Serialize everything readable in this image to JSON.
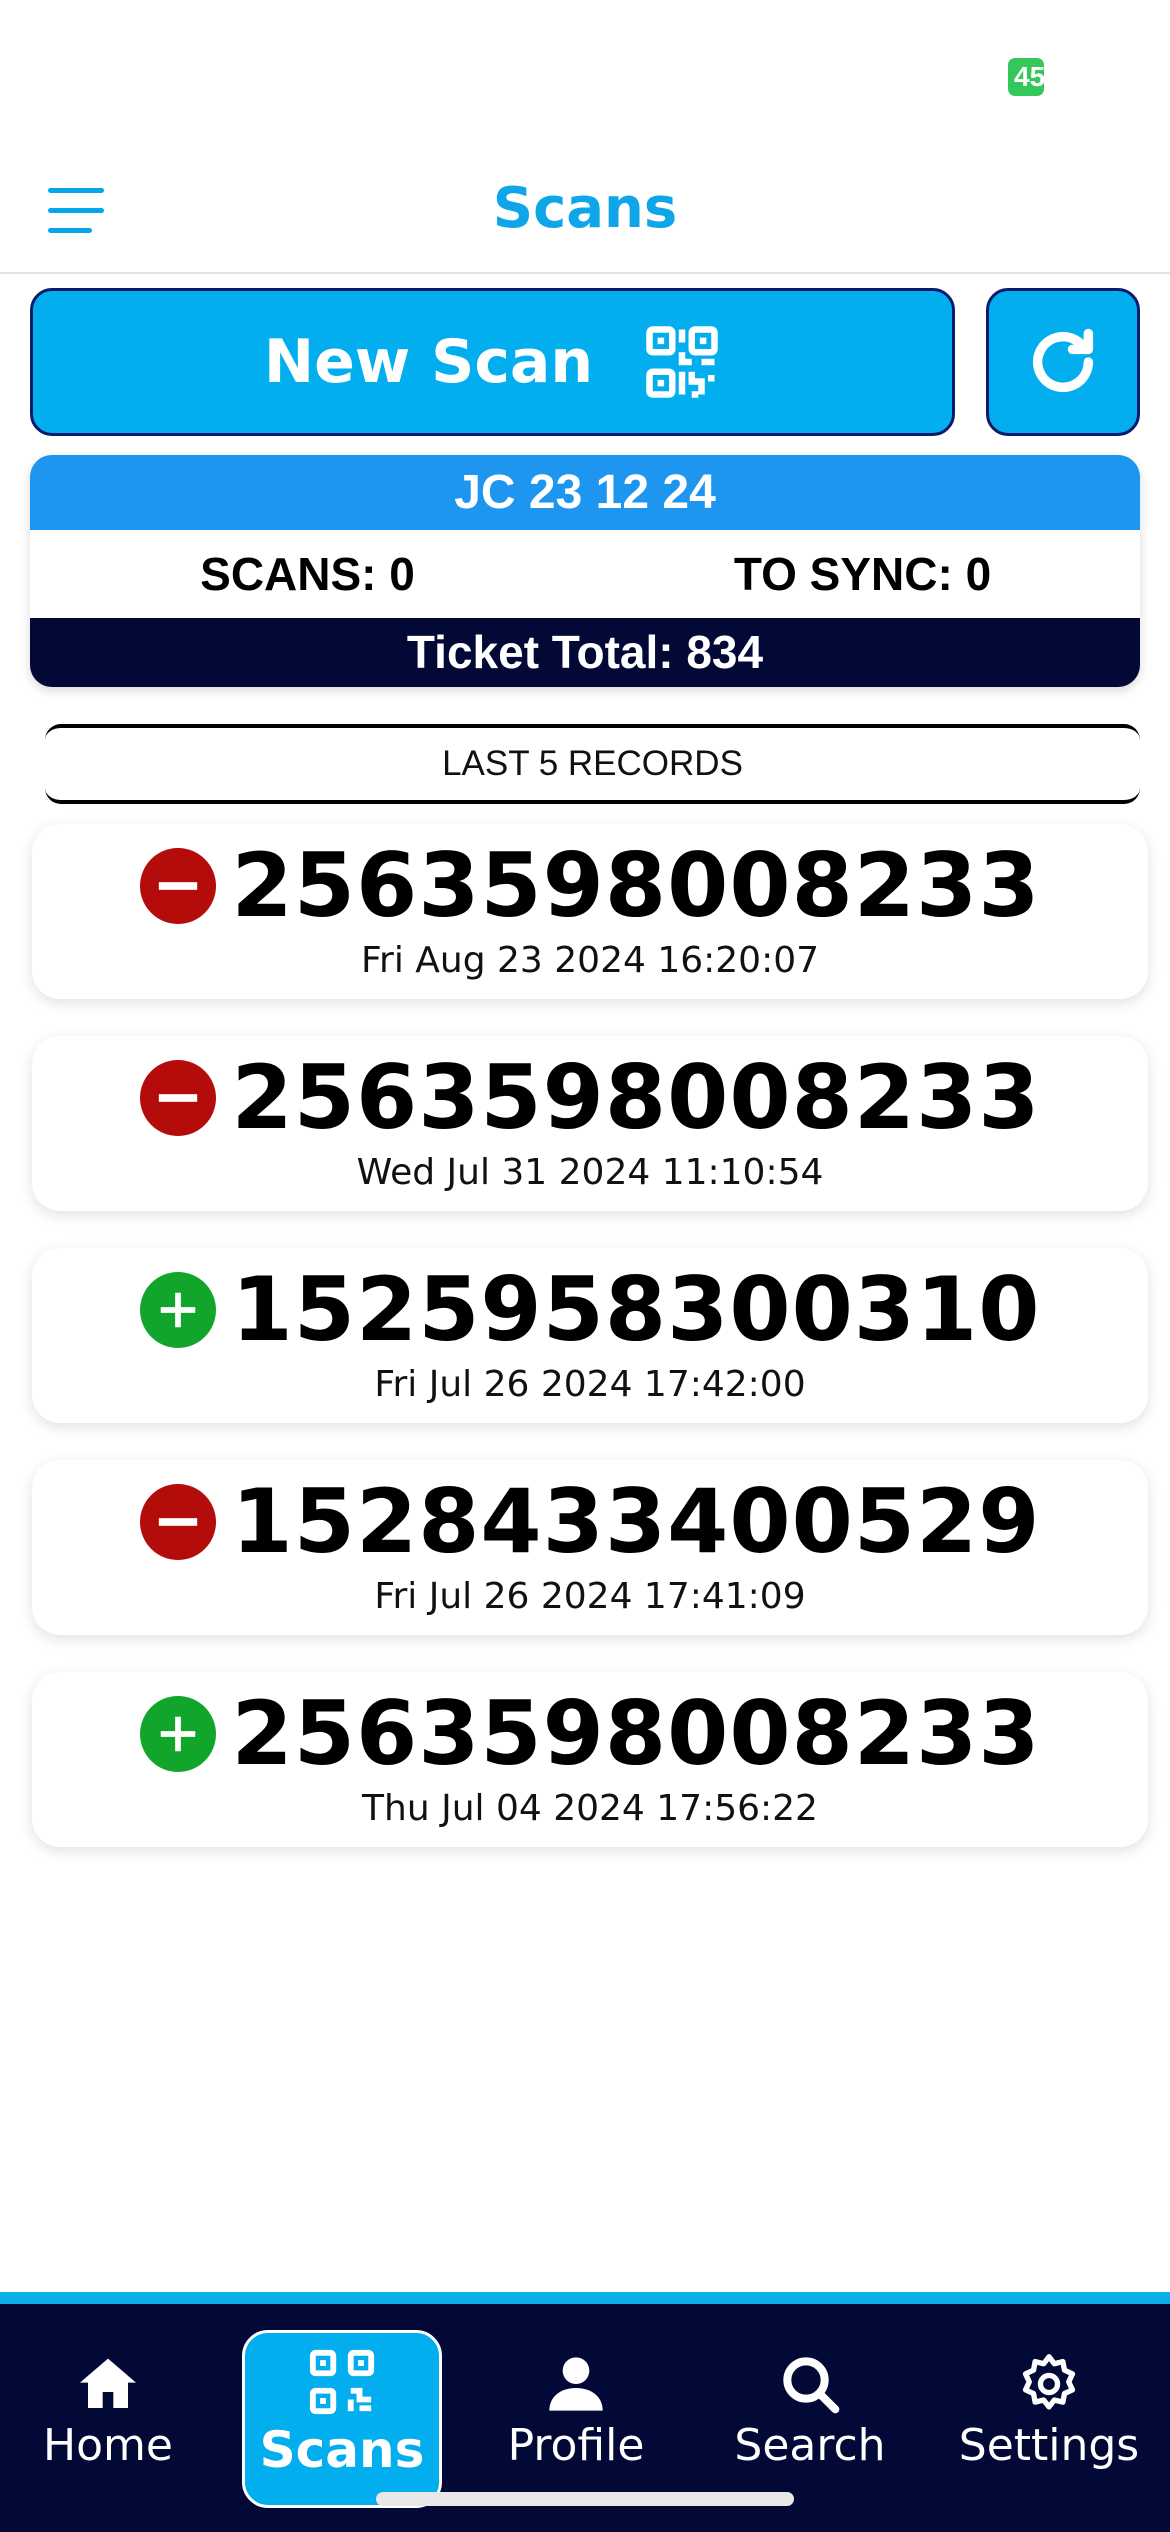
{
  "status_bar": {
    "battery": "45"
  },
  "header": {
    "title": "Scans"
  },
  "actions": {
    "new_scan_label": "New Scan"
  },
  "summary": {
    "event_name": "JC 23 12 24",
    "scans": "SCANS: 0",
    "to_sync": "TO SYNC: 0",
    "ticket_total": "Ticket Total: 834"
  },
  "records": {
    "title": "LAST 5 RECORDS",
    "items": [
      {
        "status": "rejected",
        "code": "2563598008233",
        "date": "Fri Aug 23 2024 16:20:07"
      },
      {
        "status": "rejected",
        "code": "2563598008233",
        "date": "Wed Jul 31 2024 11:10:54"
      },
      {
        "status": "accepted",
        "code": "1525958300310",
        "date": "Fri Jul 26 2024 17:42:00"
      },
      {
        "status": "rejected",
        "code": "1528433400529",
        "date": "Fri Jul 26 2024 17:41:09"
      },
      {
        "status": "accepted",
        "code": "2563598008233",
        "date": "Thu Jul 04 2024 17:56:22"
      }
    ]
  },
  "tabbar": {
    "items": [
      {
        "label": "Home",
        "icon": "home-icon"
      },
      {
        "label": "Scans",
        "icon": "qr-code-icon",
        "active": true
      },
      {
        "label": "Profile",
        "icon": "user-icon"
      },
      {
        "label": "Search",
        "icon": "search-icon"
      },
      {
        "label": "Settings",
        "icon": "gear-icon"
      }
    ]
  },
  "colors": {
    "accent": "#03aeef",
    "navy": "#030936",
    "blue": "#1e96ef",
    "rejected": "#b40b0b",
    "accepted": "#12a52b"
  }
}
